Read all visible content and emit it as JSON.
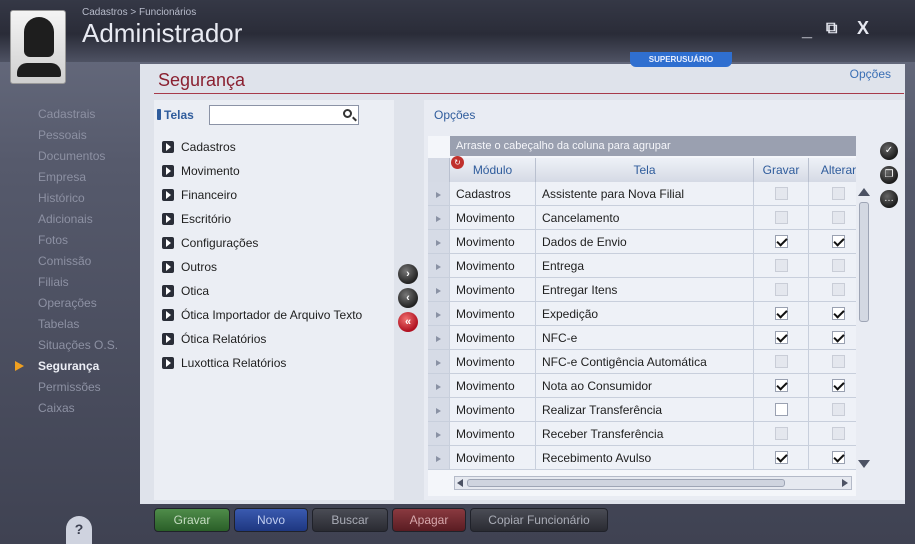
{
  "window": {
    "breadcrumb": "Cadastros > Funcionários",
    "title": "Administrador",
    "minimize": "_",
    "restore": "⧉",
    "close": "X"
  },
  "badge": "SUPERUSUÁRIO",
  "sidebar": {
    "items": [
      {
        "label": "Cadastrais",
        "active": false
      },
      {
        "label": "Pessoais",
        "active": false
      },
      {
        "label": "Documentos",
        "active": false
      },
      {
        "label": "Empresa",
        "active": false
      },
      {
        "label": "Histórico",
        "active": false
      },
      {
        "label": "Adicionais",
        "active": false
      },
      {
        "label": "Fotos",
        "active": false
      },
      {
        "label": "Comissão",
        "active": false
      },
      {
        "label": "Filiais",
        "active": false
      },
      {
        "label": "Operações",
        "active": false
      },
      {
        "label": "Tabelas",
        "active": false
      },
      {
        "label": "Situações O.S.",
        "active": false
      },
      {
        "label": "Segurança",
        "active": true
      },
      {
        "label": "Permissões",
        "active": false
      },
      {
        "label": "Caixas",
        "active": false
      }
    ],
    "help_icon": "?"
  },
  "section": {
    "title": "Segurança",
    "link": "Opções"
  },
  "telas": {
    "label": "Telas",
    "search_value": "",
    "search_placeholder": "",
    "items": [
      "Cadastros",
      "Movimento",
      "Financeiro",
      "Escritório",
      "Configurações",
      "Outros",
      "Otica",
      "Ótica Importador de Arquivo Texto",
      "Ótica Relatórios",
      "Luxottica Relatórios"
    ]
  },
  "transfer": {
    "right": "›",
    "left": "‹",
    "all_left": "«"
  },
  "opcoes": {
    "label": "Opções",
    "group_hint": "Arraste o cabeçalho da coluna para agrupar",
    "columns": [
      "Módulo",
      "Tela",
      "Gravar",
      "Alterar"
    ],
    "rows": [
      {
        "modulo": "Cadastros",
        "tela": "Assistente para Nova Filial",
        "gravar": "disabled",
        "alterar": "disabled"
      },
      {
        "modulo": "Movimento",
        "tela": "Cancelamento",
        "gravar": "disabled",
        "alterar": "disabled"
      },
      {
        "modulo": "Movimento",
        "tela": "Dados de Envio",
        "gravar": "checked",
        "alterar": "checked"
      },
      {
        "modulo": "Movimento",
        "tela": "Entrega",
        "gravar": "disabled",
        "alterar": "disabled"
      },
      {
        "modulo": "Movimento",
        "tela": "Entregar Itens",
        "gravar": "disabled",
        "alterar": "disabled"
      },
      {
        "modulo": "Movimento",
        "tela": "Expedição",
        "gravar": "checked",
        "alterar": "checked"
      },
      {
        "modulo": "Movimento",
        "tela": "NFC-e",
        "gravar": "checked",
        "alterar": "checked"
      },
      {
        "modulo": "Movimento",
        "tela": "NFC-e Contigência Automática",
        "gravar": "disabled",
        "alterar": "disabled"
      },
      {
        "modulo": "Movimento",
        "tela": "Nota ao Consumidor",
        "gravar": "checked",
        "alterar": "checked"
      },
      {
        "modulo": "Movimento",
        "tela": "Realizar Transferência",
        "gravar": "unchecked",
        "alterar": "disabled"
      },
      {
        "modulo": "Movimento",
        "tela": "Receber Transferência",
        "gravar": "disabled",
        "alterar": "disabled"
      },
      {
        "modulo": "Movimento",
        "tela": "Recebimento Avulso",
        "gravar": "checked",
        "alterar": "checked"
      }
    ]
  },
  "actions": {
    "gravar": "Gravar",
    "novo": "Novo",
    "buscar": "Buscar",
    "apagar": "Apagar",
    "copiar": "Copiar Funcionário"
  },
  "colors": {
    "accent": "#2f5c9c",
    "section_title": "#8a2030",
    "badge": "#2f6fd0",
    "active_marker": "#f0a020"
  }
}
